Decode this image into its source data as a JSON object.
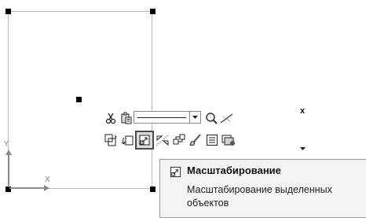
{
  "canvas": {
    "axis_y_label": "Y",
    "axis_x_label": "X"
  },
  "toolbar": {
    "row1": {
      "cut_icon": "scissors-icon",
      "paste_icon": "paste-icon",
      "line_style_value": "",
      "zoom_icon": "zoom-icon",
      "snap_icon": "snap-line-icon"
    },
    "row2": {
      "icons": [
        "move-icon",
        "rotate-icon",
        "scale-icon",
        "mirror-icon",
        "copy-array-icon",
        "format-brush-icon",
        "properties-icon",
        "layer-icon"
      ],
      "active_index": 2
    },
    "close_label": "x"
  },
  "tooltip": {
    "title": "Масштабирование",
    "description": "Масштабирование выделенных объектов"
  },
  "colors": {
    "canvas_bg": "#ffffff",
    "tooltip_bg": "#f4f4f4",
    "axis": "#8a8a8a",
    "handle": "#000000"
  }
}
